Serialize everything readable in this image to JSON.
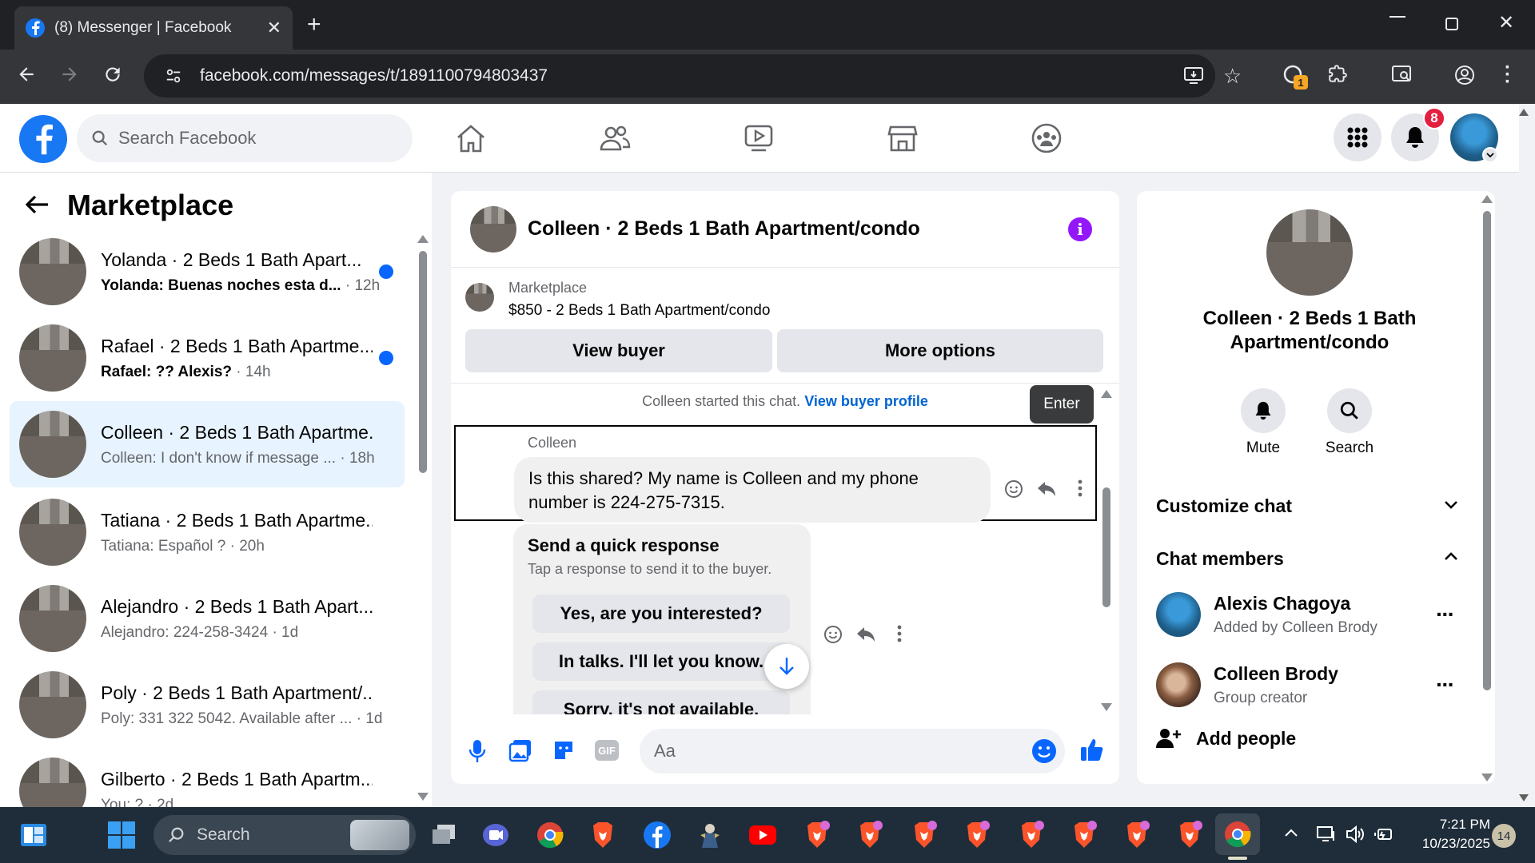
{
  "browser": {
    "tab_title": "(8) Messenger | Facebook",
    "url": "facebook.com/messages/t/1891100794803437",
    "extension_badge": "1"
  },
  "header": {
    "search_placeholder": "Search Facebook",
    "notification_count": "8"
  },
  "left": {
    "title": "Marketplace",
    "conversations": [
      {
        "name": "Yolanda · 2 Beds 1 Bath Apart...",
        "preview": "Yolanda: Buenas noches esta d...",
        "time": "· 12h",
        "unread": true
      },
      {
        "name": "Rafael · 2 Beds 1 Bath Apartme...",
        "preview": "Rafael: ?? Alexis?",
        "time": "· 14h",
        "unread": true
      },
      {
        "name": "Colleen · 2 Beds 1 Bath Apartme...",
        "preview": "Colleen: I don't know if message ...",
        "time": "· 18h",
        "unread": false
      },
      {
        "name": "Tatiana · 2 Beds 1 Bath Apartme...",
        "preview": "Tatiana: Español ?",
        "time": "· 20h",
        "unread": false
      },
      {
        "name": "Alejandro · 2 Beds 1 Bath Apart...",
        "preview": "Alejandro: 224-258-3424",
        "time": "· 1d",
        "unread": false
      },
      {
        "name": "Poly · 2 Beds 1 Bath Apartment/...",
        "preview": "Poly: 331 322 5042. Available after ...",
        "time": "· 1d",
        "unread": false
      },
      {
        "name": "Gilberto · 2 Beds 1 Bath Apartm...",
        "preview": "You: ?",
        "time": "· 2d",
        "unread": false
      }
    ]
  },
  "chat": {
    "title": "Colleen · 2 Beds 1 Bath Apartment/condo",
    "listing_label": "Marketplace",
    "listing_title": "$850 - 2 Beds 1 Bath Apartment/condo",
    "view_buyer": "View buyer",
    "more_options": "More options",
    "started_note": "Colleen started this chat.",
    "view_buyer_profile": "View buyer profile",
    "tooltip": "Enter",
    "sender": "Colleen",
    "message": "Is this shared? My name is Colleen and my phone number is 224-275-7315.",
    "quick_title": "Send a quick response",
    "quick_sub": "Tap a response to send it to the buyer.",
    "quick_responses": [
      "Yes, are you interested?",
      "In talks. I'll let you know.",
      "Sorry, it's not available."
    ],
    "composer_placeholder": "Aa"
  },
  "right": {
    "name": "Colleen · 2 Beds 1 Bath Apartment/condo",
    "mute": "Mute",
    "search": "Search",
    "customize": "Customize chat",
    "members_title": "Chat members",
    "members": [
      {
        "name": "Alexis Chagoya",
        "sub": "Added by Colleen Brody"
      },
      {
        "name": "Colleen Brody",
        "sub": "Group creator"
      }
    ],
    "add_people": "Add people"
  },
  "taskbar": {
    "search": "Search",
    "time": "7:21 PM",
    "date": "10/23/2025",
    "notif": "14"
  },
  "colors": {
    "accent": "#1877f2",
    "unread_dot": "#0866ff",
    "info": "#9317f8",
    "badge": "#e41e3f"
  }
}
